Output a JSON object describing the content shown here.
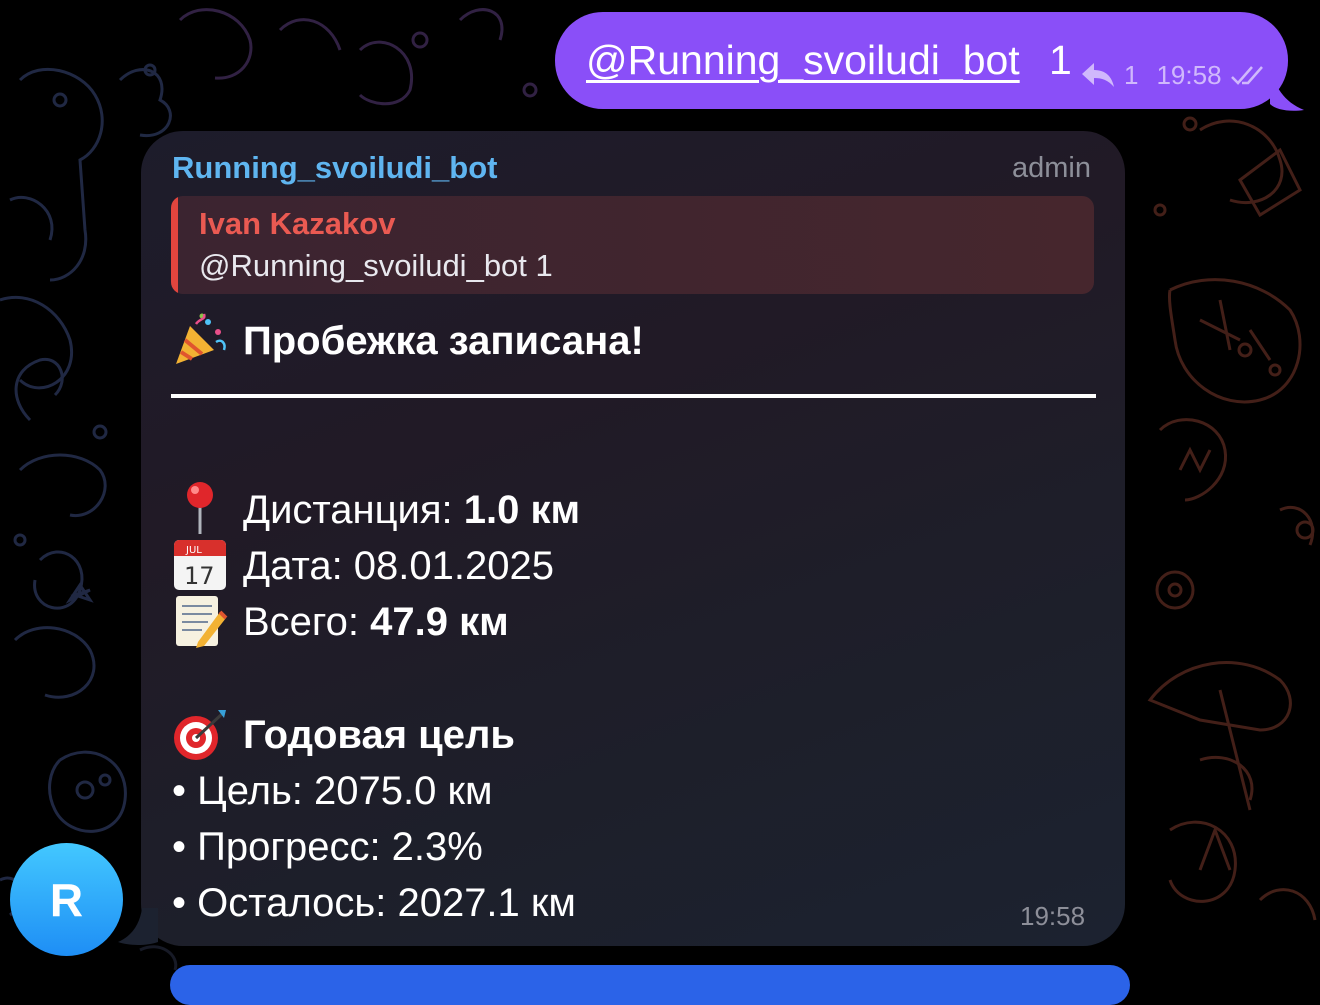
{
  "outgoing": {
    "mention": "@Running_svoiludi_bot",
    "count": "1",
    "reply_count": "1",
    "time": "19:58",
    "icons": [
      "reply-icon",
      "double-check-icon"
    ]
  },
  "incoming": {
    "sender": "Running_svoiludi_bot",
    "role": "admin",
    "reply": {
      "author": "Ivan Kazakov",
      "text": "@Running_svoiludi_bot 1"
    },
    "headline": "Пробежка записана!",
    "distance_label": "Дистанция: ",
    "distance_value": "1.0 км",
    "date_label": "Дата: 08.01.2025",
    "total_label": "Всего: ",
    "total_value": "47.9 км",
    "goal_title": "Годовая цель",
    "goal_items": [
      "• Цель: 2075.0 км",
      "• Прогресс: 2.3%",
      "• Осталось: 2027.1 км"
    ],
    "time": "19:58",
    "emoji_names": [
      "party-popper-icon",
      "pushpin-icon",
      "calendar-icon",
      "memo-icon",
      "dart-target-icon"
    ],
    "calendar_month": "JUL",
    "calendar_day": "17"
  },
  "avatar": {
    "letter": "R"
  },
  "colors": {
    "outgoing_bubble": "#8a4ff8",
    "sender_name": "#5fb5f0",
    "reply_accent": "#e2453e",
    "avatar": "#1e8ef5"
  }
}
